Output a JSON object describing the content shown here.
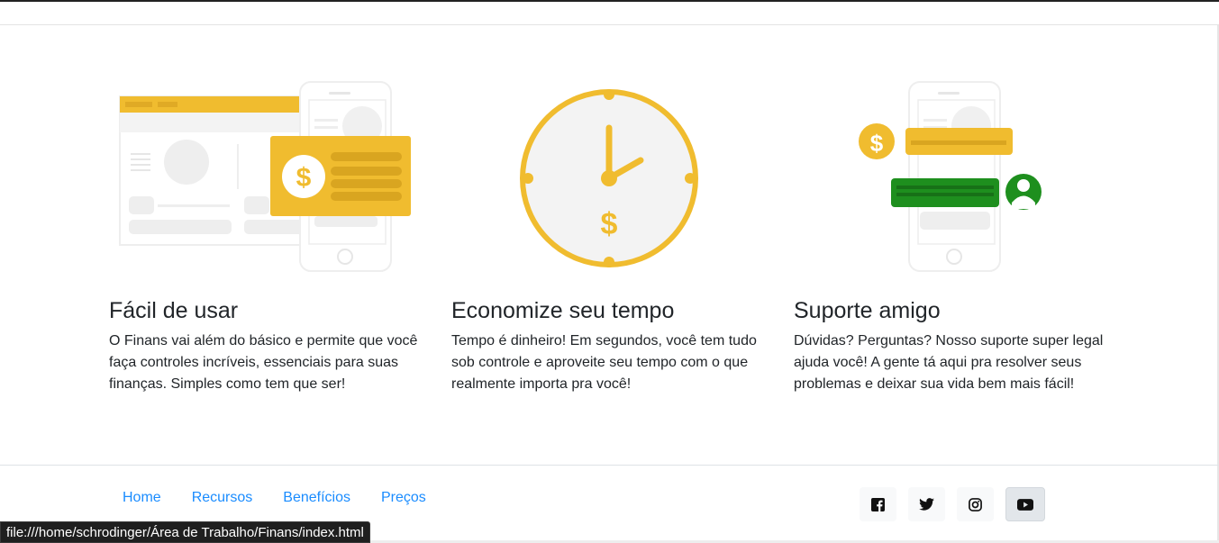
{
  "features": [
    {
      "title": "Fácil de usar",
      "text": "O Finans vai além do básico e permite que você faça controles incríveis, essenciais para suas finanças. Simples como tem que ser!",
      "icon": "dashboard-phone-money-icon"
    },
    {
      "title": "Economize seu tempo",
      "text": "Tempo é dinheiro! Em segundos, você tem tudo sob controle e aproveite seu tempo com o que realmente importa pra você!",
      "icon": "clock-money-icon"
    },
    {
      "title": "Suporte amigo",
      "text": "Dúvidas? Perguntas? Nosso suporte super legal ajuda você! A gente tá aqui pra resolver seus problemas e deixar sua vida bem mais fácil!",
      "icon": "phone-chat-support-icon"
    }
  ],
  "footer": {
    "nav": [
      "Home",
      "Recursos",
      "Benefícios",
      "Preços"
    ],
    "social": [
      "facebook-icon",
      "twitter-icon",
      "instagram-icon",
      "youtube-icon"
    ]
  },
  "status_url": "file:///home/schrodinger/Área de Trabalho/Finans/index.html",
  "colors": {
    "accent": "#f0bc2f",
    "link": "#1a8cff",
    "support_green": "#1e8f1e"
  }
}
